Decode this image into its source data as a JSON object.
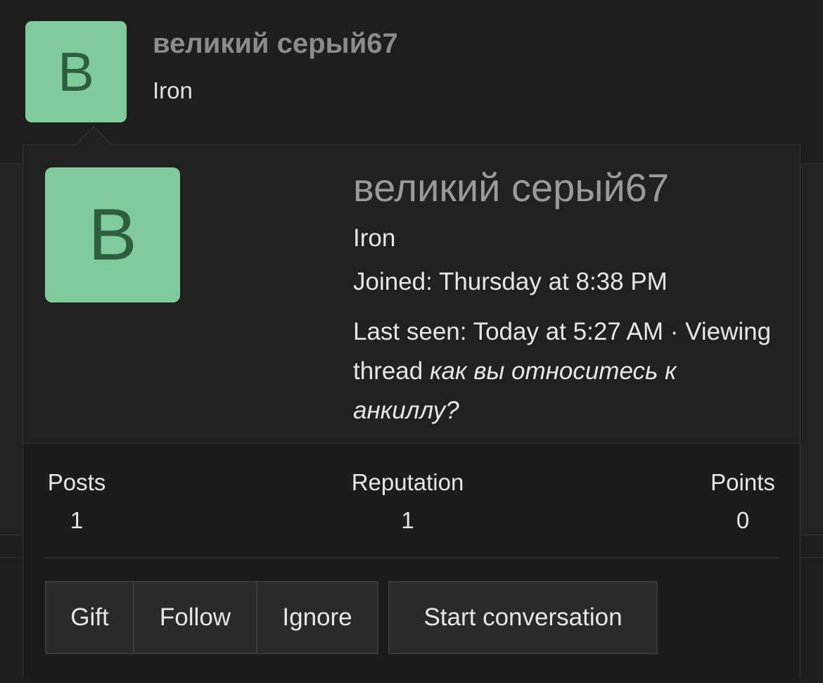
{
  "header": {
    "avatar_letter": "B",
    "username": "великий серый67",
    "user_title": "Iron"
  },
  "card": {
    "avatar_letter": "B",
    "username": "великий серый67",
    "user_title": "Iron",
    "joined": "Joined: Thursday at 8:38 PM",
    "last_seen": "Last seen: Today at 5:27 AM ·",
    "viewing_prefix": "Viewing thread",
    "viewing_thread": "как вы относитесь к анкиллу?",
    "stats": {
      "posts_label": "Posts",
      "posts_value": "1",
      "reputation_label": "Reputation",
      "reputation_value": "1",
      "points_label": "Points",
      "points_value": "0"
    },
    "buttons": {
      "gift": "Gift",
      "follow": "Follow",
      "ignore": "Ignore",
      "start_conversation": "Start conversation"
    }
  },
  "colors": {
    "avatar_bg": "#7fcb9b",
    "avatar_letter": "#2f5e3e",
    "username": "#9a9a9a",
    "background": "#1e1e1f"
  }
}
